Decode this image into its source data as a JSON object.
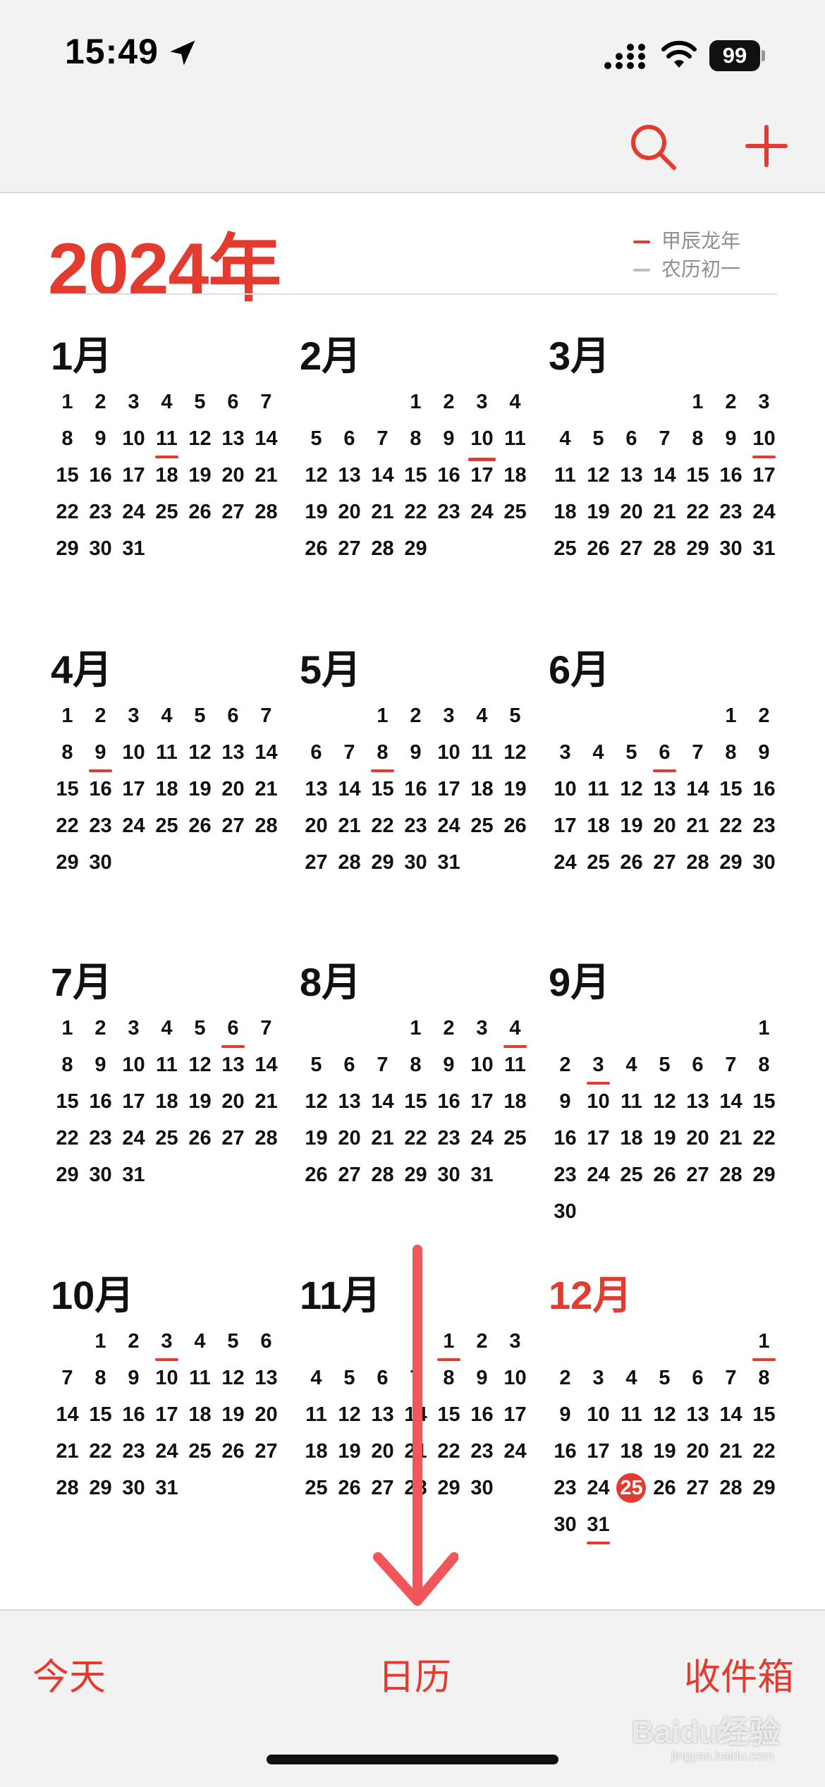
{
  "status_bar": {
    "time": "15:49",
    "battery": "99"
  },
  "toolbar": {
    "search_icon": "magnifying-glass",
    "add_icon": "plus"
  },
  "year_title": "2024年",
  "legend": [
    {
      "label": "甲辰龙年",
      "color": "#e43b31"
    },
    {
      "label": "农历初一",
      "color": "#bdbdbd"
    }
  ],
  "weekday_start": "Monday",
  "months": [
    {
      "label": "1月",
      "offset": 0,
      "days": 31,
      "lunar_first": [
        11
      ],
      "major": []
    },
    {
      "label": "2月",
      "offset": 3,
      "days": 29,
      "lunar_first": [],
      "major": [
        10
      ]
    },
    {
      "label": "3月",
      "offset": 4,
      "days": 31,
      "lunar_first": [
        10
      ],
      "major": []
    },
    {
      "label": "4月",
      "offset": 0,
      "days": 30,
      "lunar_first": [
        9
      ],
      "major": []
    },
    {
      "label": "5月",
      "offset": 2,
      "days": 31,
      "lunar_first": [
        8
      ],
      "major": []
    },
    {
      "label": "6月",
      "offset": 5,
      "days": 30,
      "lunar_first": [
        6
      ],
      "major": []
    },
    {
      "label": "7月",
      "offset": 0,
      "days": 31,
      "lunar_first": [
        6
      ],
      "major": []
    },
    {
      "label": "8月",
      "offset": 3,
      "days": 31,
      "lunar_first": [
        4
      ],
      "major": []
    },
    {
      "label": "9月",
      "offset": 6,
      "days": 30,
      "lunar_first": [
        3
      ],
      "major": []
    },
    {
      "label": "10月",
      "offset": 1,
      "days": 31,
      "lunar_first": [
        3
      ],
      "major": []
    },
    {
      "label": "11月",
      "offset": 4,
      "days": 30,
      "lunar_first": [
        1
      ],
      "major": []
    },
    {
      "label": "12月",
      "offset": 6,
      "days": 31,
      "lunar_first": [
        1,
        31
      ],
      "major": [],
      "current": true,
      "today": 25
    }
  ],
  "tabs": {
    "today": "今天",
    "calendars": "日历",
    "inbox": "收件箱"
  },
  "watermark": {
    "text": "Baidu经验",
    "url": "jingyan.baidu.com"
  }
}
